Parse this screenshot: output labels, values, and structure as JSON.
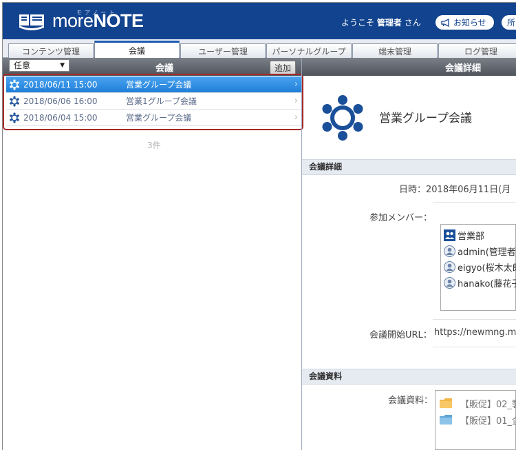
{
  "header": {
    "logo_ruby": "モアノート",
    "logo_light": "more",
    "logo_bold": "NOTE",
    "welcome_prefix": "ようこそ",
    "user_name": "管理者",
    "welcome_suffix": "さん",
    "notice_label": "お知らせ",
    "extra_label": "所"
  },
  "tabs": [
    {
      "label": "コンテンツ管理"
    },
    {
      "label": "会議"
    },
    {
      "label": "ユーザー管理"
    },
    {
      "label": "パーソナルグループ"
    },
    {
      "label": "端末管理"
    },
    {
      "label": "ログ管理"
    }
  ],
  "list_panel": {
    "filter_value": "任意",
    "title": "会議",
    "add_label": "追加",
    "meetings": [
      {
        "datetime": "2018/06/11 15:00",
        "name": "営業グループ会議"
      },
      {
        "datetime": "2018/06/06 16:00",
        "name": "営業1グループ会議"
      },
      {
        "datetime": "2018/06/04 15:00",
        "name": "営業グループ会議"
      }
    ],
    "count": "3件"
  },
  "detail_panel": {
    "title": "会議詳細",
    "meeting_name": "営業グループ会議",
    "section_details": "会議詳細",
    "datetime_text": "日時：2018年06月11日(月",
    "members_label": "参加メンバー：",
    "members": [
      {
        "name": "営業部",
        "icon": "group-icon"
      },
      {
        "name": "admin(管理者",
        "icon": "user-icon"
      },
      {
        "name": "eigyo(桜木太郎",
        "icon": "user-icon"
      },
      {
        "name": "hanako(藤花子",
        "icon": "user-icon"
      }
    ],
    "url_label": "会議開始URL：",
    "url_value": "https://newmng.m",
    "section_materials": "会議資料",
    "materials_label": "会議資料：",
    "materials": [
      {
        "name": "【販促】02_製"
      },
      {
        "name": "【販促】01_企"
      }
    ]
  },
  "colors": {
    "header_bg": "#12438e",
    "selected_row": "#2f8ee3",
    "highlight_frame": "#a52a2a",
    "meeting_icon": "#1a4f99"
  }
}
